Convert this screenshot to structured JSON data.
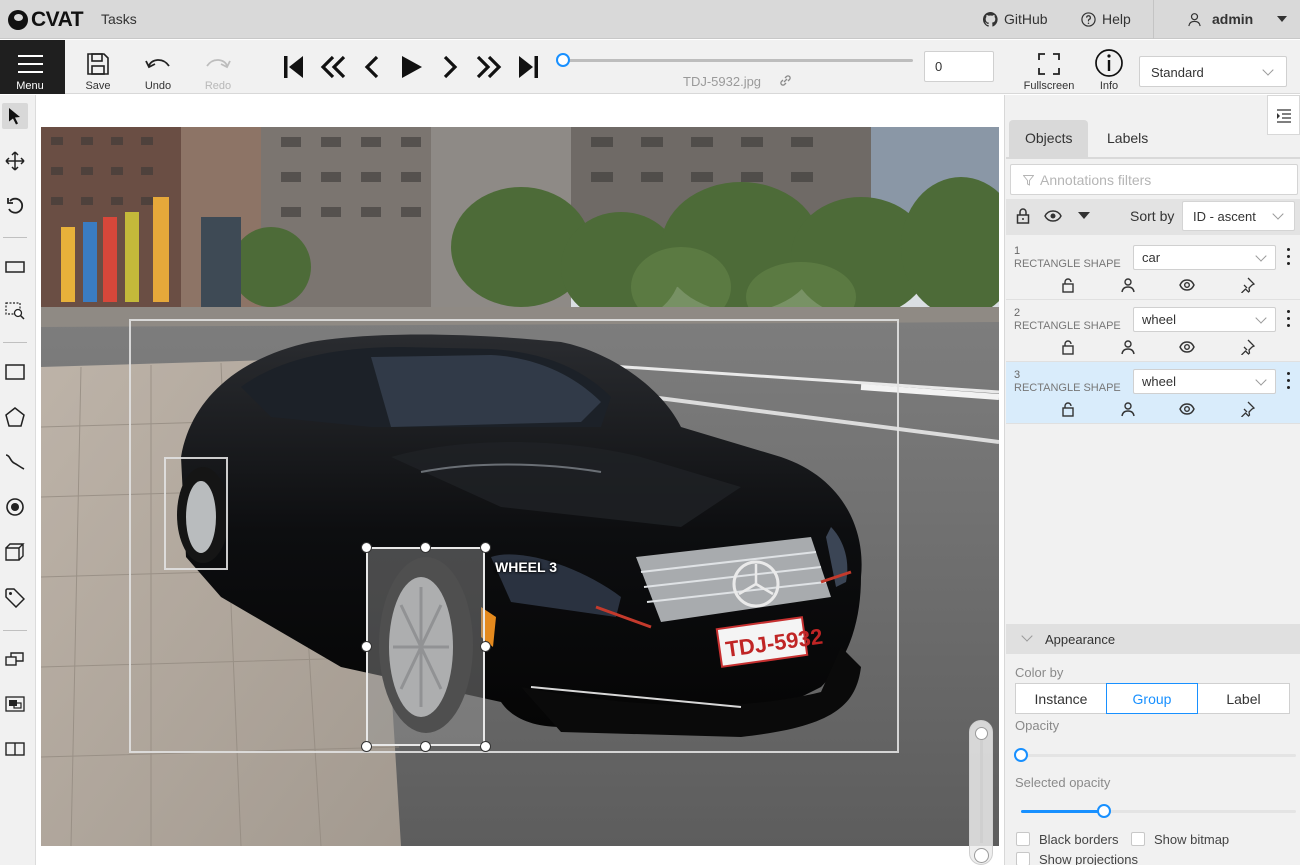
{
  "header": {
    "logo_text": "CVAT",
    "tasks_label": "Tasks",
    "github_label": "GitHub",
    "help_label": "Help",
    "user_label": "admin"
  },
  "toolbar": {
    "menu_label": "Menu",
    "save_label": "Save",
    "undo_label": "Undo",
    "redo_label": "Redo",
    "filename": "TDJ-5932.jpg",
    "frame_value": "0",
    "fullscreen_label": "Fullscreen",
    "info_label": "Info",
    "workspace_value": "Standard",
    "playback_progress": 0
  },
  "canvas": {
    "selected_label_text": "WHEEL 3",
    "plate_text": "TDJ-5932"
  },
  "sidebar": {
    "tabs": [
      {
        "label": "Objects"
      },
      {
        "label": "Labels"
      }
    ],
    "filter_placeholder": "Annotations filters",
    "sort_label": "Sort by",
    "sort_value": "ID - ascent",
    "objects": [
      {
        "id": "1",
        "type": "RECTANGLE SHAPE",
        "label": "car"
      },
      {
        "id": "2",
        "type": "RECTANGLE SHAPE",
        "label": "wheel"
      },
      {
        "id": "3",
        "type": "RECTANGLE SHAPE",
        "label": "wheel"
      }
    ],
    "appearance": {
      "title": "Appearance",
      "color_by_label": "Color by",
      "color_by_options": [
        "Instance",
        "Group",
        "Label"
      ],
      "color_by_selected": "Group",
      "opacity_label": "Opacity",
      "opacity_value": 0,
      "selected_opacity_label": "Selected opacity",
      "selected_opacity_value": 0.3,
      "black_borders_label": "Black borders",
      "show_bitmap_label": "Show bitmap",
      "show_projections_label": "Show projections"
    }
  },
  "colors": {
    "accent": "#1890ff",
    "menu_bg": "#1f1f1f",
    "selected_row": "#d9ecfb"
  }
}
